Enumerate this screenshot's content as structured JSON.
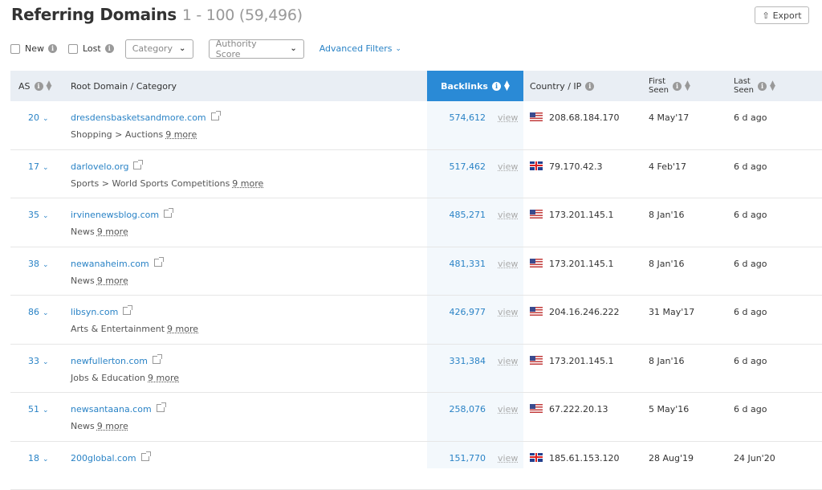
{
  "header": {
    "title": "Referring Domains",
    "range": "1 - 100 (59,496)",
    "export_label": "Export",
    "export_icon": "export-icon"
  },
  "filters": {
    "new_label": "New",
    "lost_label": "Lost",
    "category_placeholder": "Category",
    "authority_placeholder": "Authority Score",
    "advanced_label": "Advanced Filters"
  },
  "columns": {
    "as": "AS",
    "domain": "Root Domain / Category",
    "backlinks": "Backlinks",
    "country": "Country / IP",
    "first_seen_1": "First",
    "first_seen_2": "Seen",
    "last_seen_1": "Last",
    "last_seen_2": "Seen"
  },
  "colors": {
    "accent": "#2a8ad6",
    "link": "#2a83c6",
    "header_bg": "#e9eef4"
  },
  "view_label": "view",
  "rows": [
    {
      "as": "20",
      "domain": "dresdensbasketsandmore.com",
      "category": "Shopping > Auctions",
      "more": "9 more",
      "backlinks": "574,612",
      "flag": "us",
      "ip": "208.68.184.170",
      "first_seen": "4 May'17",
      "last_seen": "6 d ago"
    },
    {
      "as": "17",
      "domain": "darlovelo.org",
      "category": "Sports > World Sports Competitions",
      "more": "9 more",
      "backlinks": "517,462",
      "flag": "uk",
      "ip": "79.170.42.3",
      "first_seen": "4 Feb'17",
      "last_seen": "6 d ago"
    },
    {
      "as": "35",
      "domain": "irvinenewsblog.com",
      "category": "News",
      "more": "9 more",
      "backlinks": "485,271",
      "flag": "us",
      "ip": "173.201.145.1",
      "first_seen": "8 Jan'16",
      "last_seen": "6 d ago"
    },
    {
      "as": "38",
      "domain": "newanaheim.com",
      "category": "News",
      "more": "9 more",
      "backlinks": "481,331",
      "flag": "us",
      "ip": "173.201.145.1",
      "first_seen": "8 Jan'16",
      "last_seen": "6 d ago"
    },
    {
      "as": "86",
      "domain": "libsyn.com",
      "category": "Arts & Entertainment",
      "more": "9 more",
      "backlinks": "426,977",
      "flag": "us",
      "ip": "204.16.246.222",
      "first_seen": "31 May'17",
      "last_seen": "6 d ago"
    },
    {
      "as": "33",
      "domain": "newfullerton.com",
      "category": "Jobs & Education",
      "more": "9 more",
      "backlinks": "331,384",
      "flag": "us",
      "ip": "173.201.145.1",
      "first_seen": "8 Jan'16",
      "last_seen": "6 d ago"
    },
    {
      "as": "51",
      "domain": "newsantaana.com",
      "category": "News",
      "more": "9 more",
      "backlinks": "258,076",
      "flag": "us",
      "ip": "67.222.20.13",
      "first_seen": "5 May'16",
      "last_seen": "6 d ago"
    },
    {
      "as": "18",
      "domain": "200global.com",
      "category": "",
      "more": "",
      "backlinks": "151,770",
      "flag": "uk",
      "ip": "185.61.153.120",
      "first_seen": "28 Aug'19",
      "last_seen": "24 Jun'20"
    }
  ]
}
